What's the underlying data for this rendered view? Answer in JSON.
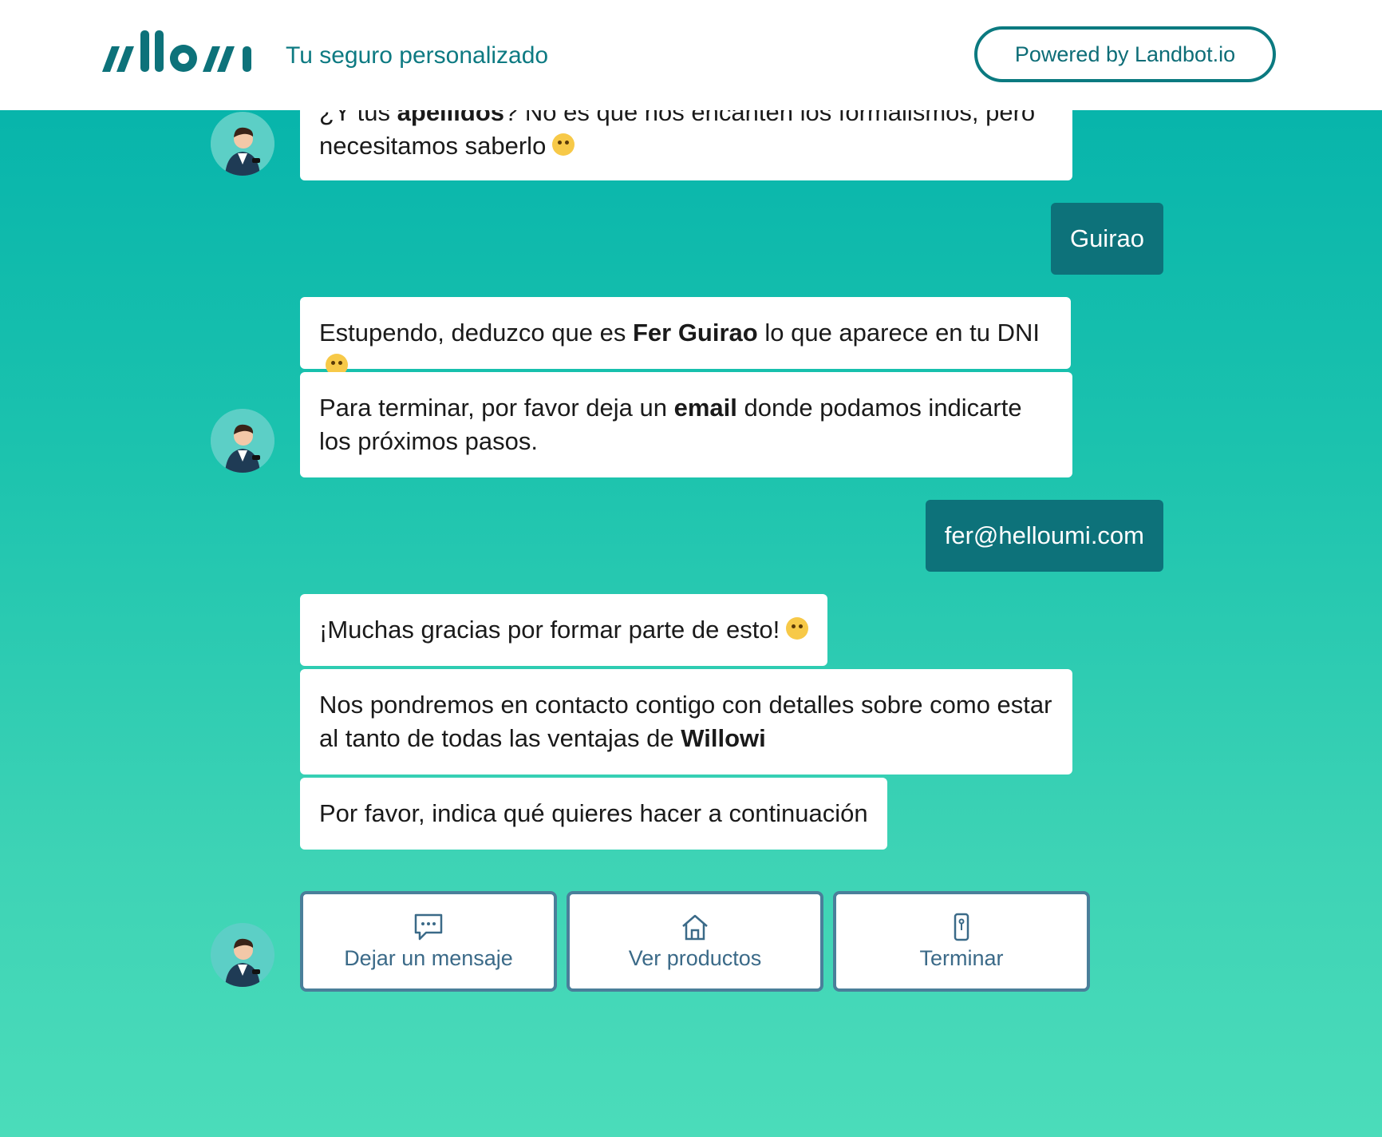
{
  "header": {
    "brand": "willowi",
    "tagline": "Tu seguro personalizado",
    "powered_label": "Powered by Landbot.io"
  },
  "messages": {
    "m1_part1": "¿Y tus ",
    "m1_bold": "apellidos",
    "m1_part2": "? No es que nos encanten los formalismos, pero necesitamos saberlo",
    "u1": "Guirao",
    "m2_part1": "Estupendo, deduzco que es ",
    "m2_bold": "Fer Guirao",
    "m2_part2": " lo que aparece en tu DNI",
    "m3_part1": "Para terminar, por favor deja un ",
    "m3_bold": "email",
    "m3_part2": " donde podamos indicarte los próximos pasos.",
    "u2": "fer@helloumi.com",
    "m4": "¡Muchas gracias por formar parte de esto!",
    "m5_part1": "Nos pondremos en contacto contigo con detalles sobre como estar al tanto de todas las ventajas de ",
    "m5_bold": "Willowi",
    "m6": "Por favor, indica qué quieres hacer a continuación"
  },
  "choices": [
    {
      "label": "Dejar un mensaje",
      "icon": "chat-bubble-icon"
    },
    {
      "label": "Ver productos",
      "icon": "house-icon"
    },
    {
      "label": "Terminar",
      "icon": "door-icon"
    }
  ],
  "colors": {
    "accent": "#0d727a",
    "gradient_top": "#01b0aa",
    "gradient_bottom": "#4bdcba",
    "choice_border": "#4a7f9a"
  }
}
